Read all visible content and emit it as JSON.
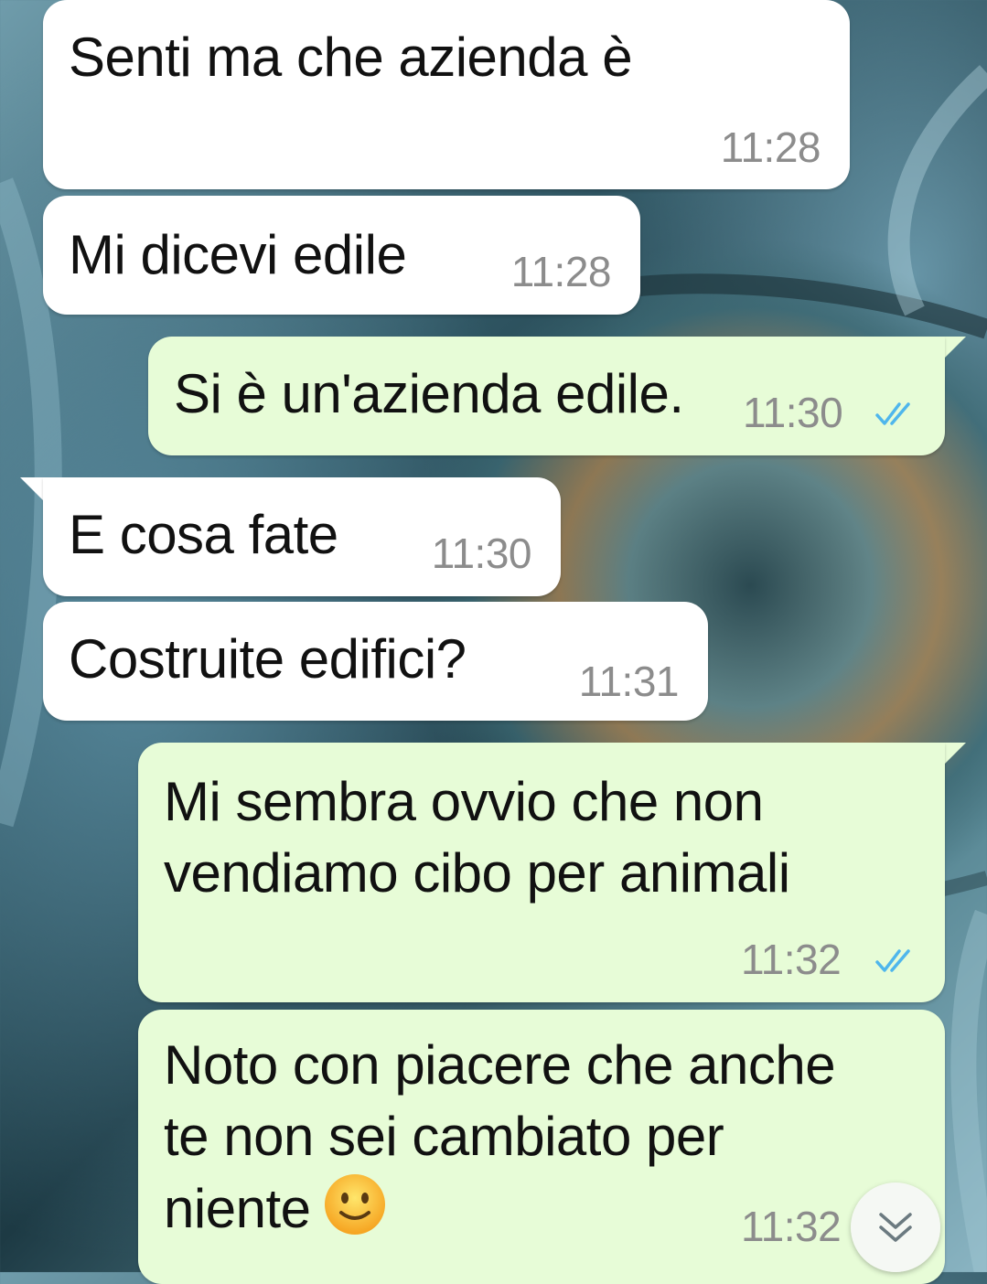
{
  "messages": [
    {
      "direction": "incoming",
      "text": "Senti ma che azienda è",
      "time": "11:28"
    },
    {
      "direction": "incoming",
      "text": "Mi dicevi edile",
      "time": "11:28"
    },
    {
      "direction": "outgoing",
      "text": "Si è un'azienda edile.",
      "time": "11:30",
      "status": "read"
    },
    {
      "direction": "incoming",
      "text": "E cosa fate",
      "time": "11:30"
    },
    {
      "direction": "incoming",
      "text": "Costruite edifici?",
      "time": "11:31"
    },
    {
      "direction": "outgoing",
      "text": "Mi sembra ovvio che non\nvendiamo cibo per animali",
      "time": "11:32",
      "status": "read"
    },
    {
      "direction": "outgoing",
      "text": "Noto con piacere che anche\nte non sei cambiato per\nniente",
      "emoji": "slightly-smiling-face",
      "time": "11:32",
      "status": "read"
    }
  ],
  "colors": {
    "incoming_bubble": "#ffffff",
    "outgoing_bubble": "#e7fcd7",
    "read_ticks": "#4fb6ec",
    "timestamp": "#8c8c8c"
  },
  "icons": {
    "read_status": "double-check-icon",
    "scroll_to_bottom": "double-chevron-down-icon",
    "emoji": "slightly-smiling-face-icon"
  }
}
